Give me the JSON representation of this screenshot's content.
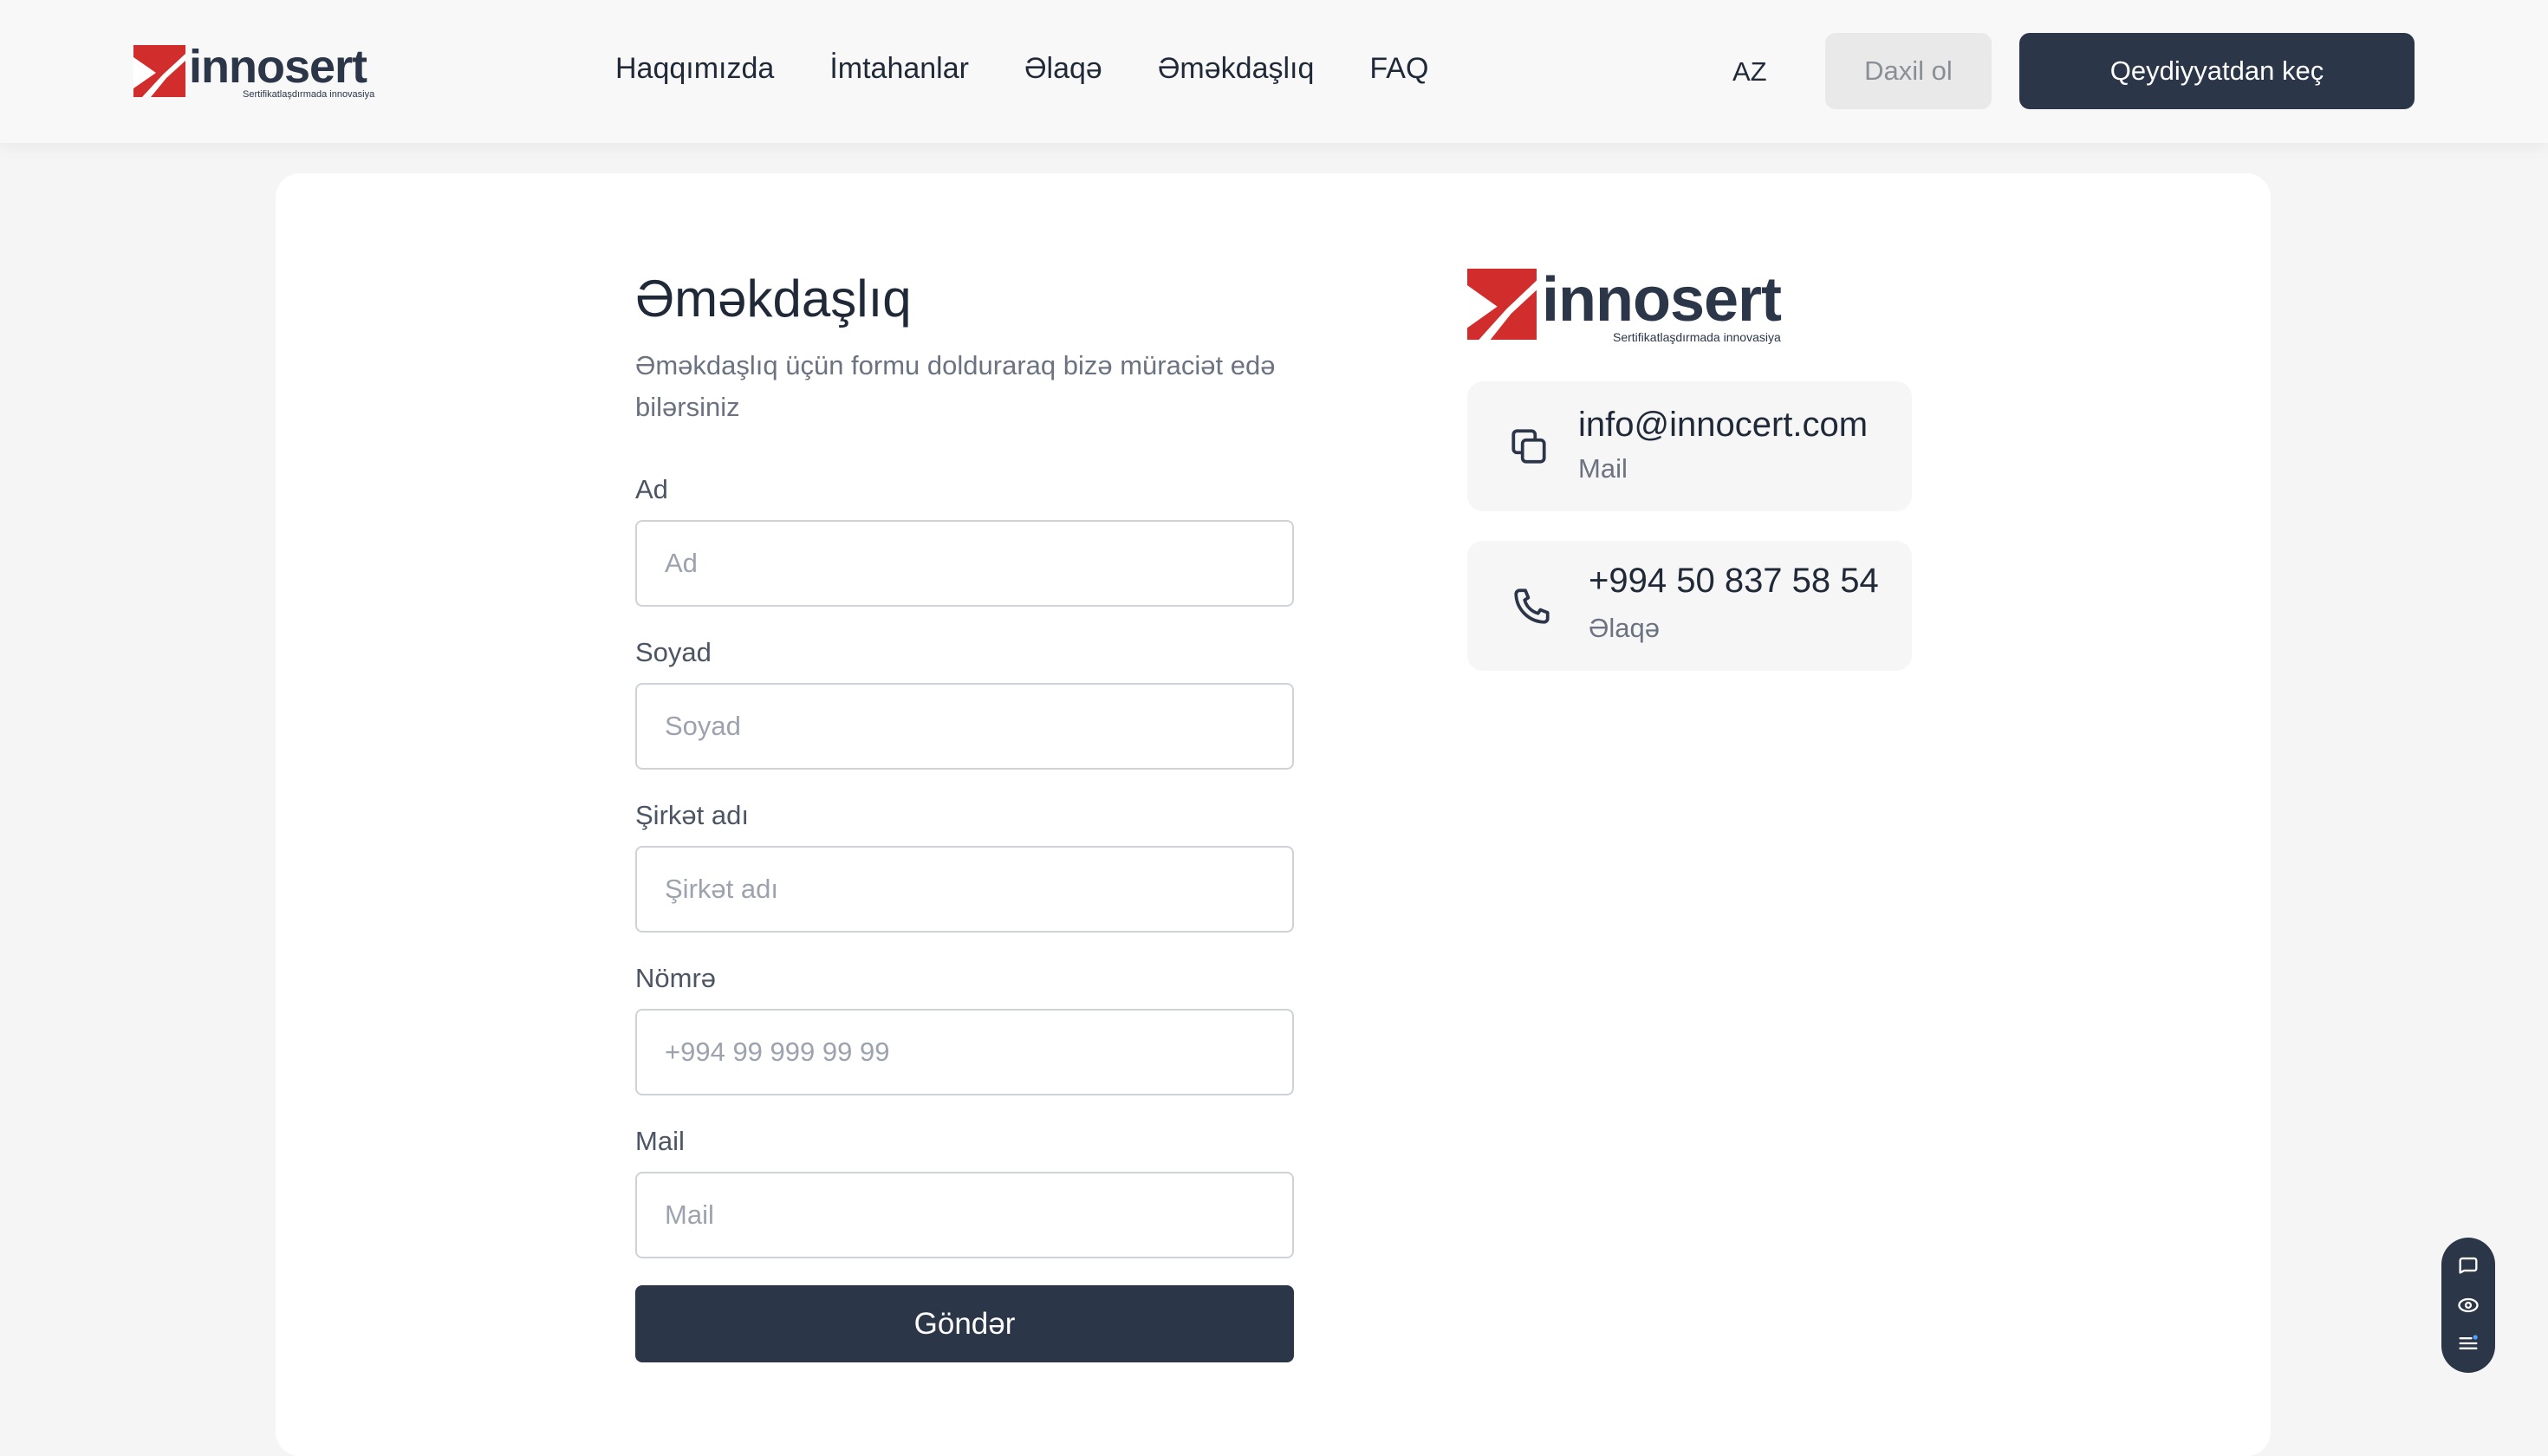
{
  "header": {
    "logo": {
      "brand": "innosert",
      "tagline": "Sertifikatlaşdırmada innovasiya"
    },
    "nav": [
      "Haqqımızda",
      "İmtahanlar",
      "Əlaqə",
      "Əməkdaşlıq",
      "FAQ"
    ],
    "language": "AZ",
    "login_label": "Daxil ol",
    "register_label": "Qeydiyyatdan keç"
  },
  "page": {
    "title": "Əməkdaşlıq",
    "subtitle": "Əməkdaşlıq üçün formu dolduraraq bizə müraciət edə bilərsiniz"
  },
  "form": {
    "fields": [
      {
        "label": "Ad",
        "placeholder": "Ad"
      },
      {
        "label": "Soyad",
        "placeholder": "Soyad"
      },
      {
        "label": "Şirkət adı",
        "placeholder": "Şirkət adı"
      },
      {
        "label": "Nömrə",
        "placeholder": "+994 99 999 99 99"
      },
      {
        "label": "Mail",
        "placeholder": "Mail"
      }
    ],
    "submit_label": "Göndər"
  },
  "contact": {
    "logo": {
      "brand": "innosert",
      "tagline": "Sertifikatlaşdırmada innovasiya"
    },
    "email": {
      "value": "info@innocert.com",
      "caption": "Mail",
      "icon": "copy-icon"
    },
    "phone": {
      "value": "+994 50 837 58 54",
      "caption": "Əlaqə",
      "icon": "phone-icon"
    }
  },
  "widget": {
    "icons": [
      "chat-icon",
      "eye-icon",
      "menu-icon"
    ]
  },
  "colors": {
    "primary": "#2b3648",
    "brand_red": "#d22d2d",
    "background": "#f5f5f6"
  }
}
